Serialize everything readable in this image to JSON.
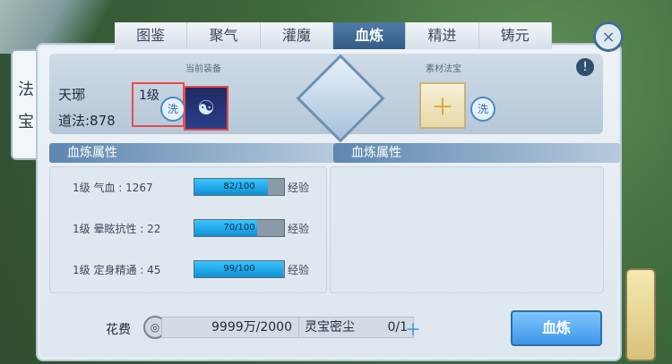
{
  "tabs": [
    "图鉴",
    "聚气",
    "灌魔",
    "血炼",
    "精进",
    "铸元"
  ],
  "side_tab": {
    "chars": [
      "法",
      "宝"
    ]
  },
  "top": {
    "equipment_caption": "当前装备",
    "material_caption": "素材法宝",
    "name": "天琊",
    "daofa": "道法:878",
    "level": "1级",
    "wash_label": "洗"
  },
  "left_header": "血炼属性",
  "right_header": "血炼属性",
  "attributes": [
    {
      "label": "1级 气血 : 1267",
      "current": 82,
      "max": 100,
      "bar_text": "82/100",
      "exp_label": "经验"
    },
    {
      "label": "1级 晕眩抗性 : 22",
      "current": 70,
      "max": 100,
      "bar_text": "70/100",
      "exp_label": "经验"
    },
    {
      "label": "1级 定身精通 : 45",
      "current": 99,
      "max": 100,
      "bar_text": "99/100",
      "exp_label": "经验"
    }
  ],
  "cost": {
    "label": "花费",
    "value": "9999万/2000"
  },
  "material": {
    "name": "灵宝密尘",
    "count": "0/1"
  },
  "refine_button": "血炼",
  "icons": {
    "close": "close-icon",
    "info": "info-icon",
    "coin": "coin-icon",
    "plus": "plus-icon"
  }
}
